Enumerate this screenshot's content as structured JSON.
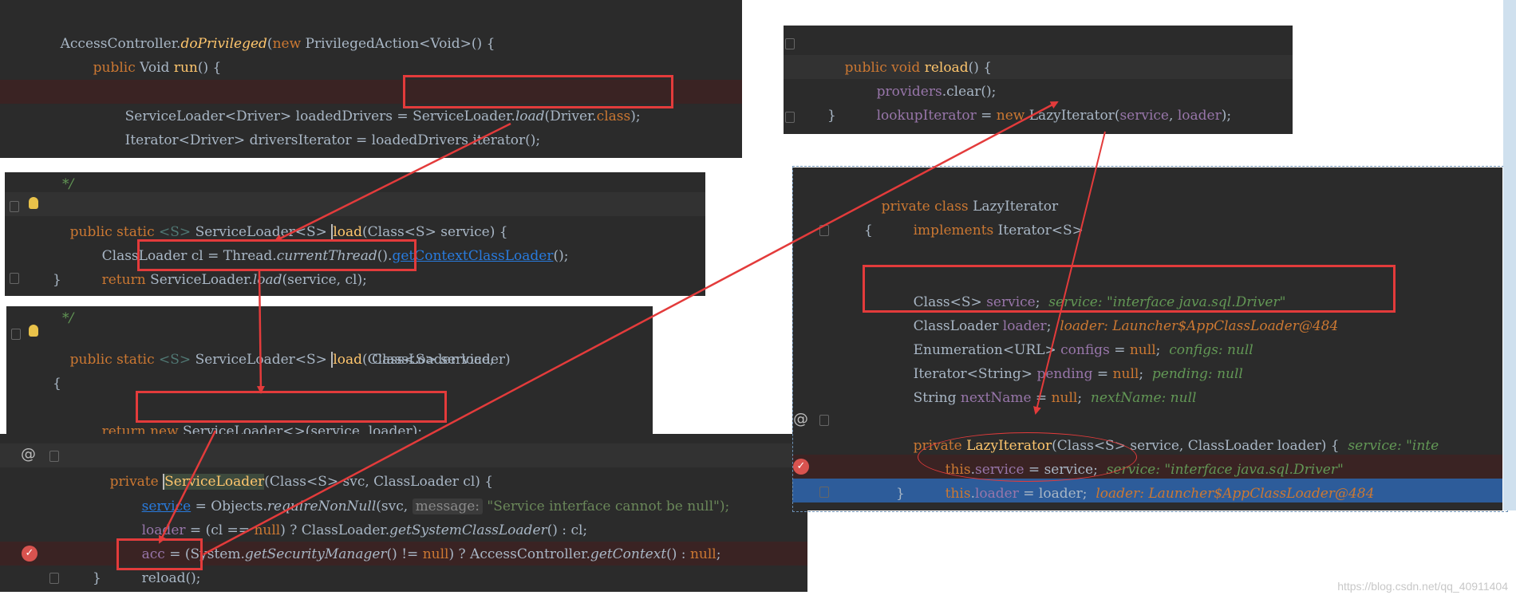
{
  "panels": {
    "p1": {
      "l1": [
        "AccessController.",
        "doPrivileged",
        "(",
        "new ",
        "PrivilegedAction<Void>() {"
      ],
      "l2": [
        "public ",
        "Void ",
        "run",
        "() {"
      ],
      "l3": [
        "ServiceLoader<Driver> loadedDrivers = ",
        "ServiceLoader.",
        "load",
        "(Driver.",
        "class",
        ");"
      ],
      "l4": [
        "Iterator<Driver> driversIterator = loadedDrivers.iterator();"
      ]
    },
    "p2": {
      "l0": [
        "*/"
      ],
      "l1": [
        "public static ",
        "<S> ",
        "ServiceLoader<S> ",
        "load",
        "(Class<S> service) {"
      ],
      "l2": [
        "ClassLoader cl = Thread.",
        "currentThread",
        "().",
        "getContextClassLoader",
        "();"
      ],
      "l3": [
        "return ",
        "ServiceLoader.",
        "load",
        "(service, cl);"
      ],
      "l4": [
        "}"
      ]
    },
    "p3": {
      "l0": [
        "*/"
      ],
      "l1": [
        "public static ",
        "<S> ",
        "ServiceLoader<S> ",
        "load",
        "(Class<S> service,"
      ],
      "l2": [
        "ClassLoader loader)"
      ],
      "l3": [
        "{"
      ],
      "l4": [
        "return ",
        "new ",
        "ServiceLoader<>(service, loader);"
      ]
    },
    "p4": {
      "l1": [
        "private ",
        "ServiceLoader",
        "(Class<S> svc, ClassLoader cl) {"
      ],
      "l2": [
        "service",
        " = Objects.",
        "requireNonNull",
        "(svc, ",
        "message:",
        " \"Service interface cannot be null\");"
      ],
      "l3": [
        "loader",
        " = (cl == ",
        "null",
        ") ? ClassLoader.",
        "getSystemClassLoader",
        "() : cl;"
      ],
      "l4": [
        "acc",
        " = (System.",
        "getSecurityManager",
        "() != ",
        "null",
        ") ? AccessController.",
        "getContext",
        "() : ",
        "null",
        ";"
      ],
      "l5": [
        "reload",
        "();"
      ],
      "l6": [
        "}"
      ]
    },
    "p5": {
      "l1": [
        "public void ",
        "reload",
        "() {"
      ],
      "l2": [
        "providers",
        ".clear();"
      ],
      "l3": [
        "lookupIterator",
        " = ",
        "new ",
        "LazyIterator(",
        "service",
        ", ",
        "loader",
        ");"
      ],
      "l4": [
        "}"
      ]
    },
    "p6": {
      "l1": [
        "private class ",
        "LazyIterator"
      ],
      "l2": [
        "implements ",
        "Iterator<S>"
      ],
      "l3": [
        "{"
      ],
      "l4": [
        "Class<S> ",
        "service",
        ";  ",
        "service: \"interface java.sql.Driver\""
      ],
      "l5": [
        "ClassLoader ",
        "loader",
        ";  ",
        "loader: Launcher$AppClassLoader@484"
      ],
      "l6": [
        "Enumeration<URL> ",
        "configs",
        " = ",
        "null",
        ";  ",
        "configs: null"
      ],
      "l7": [
        "Iterator<String> ",
        "pending",
        " = ",
        "null",
        ";  ",
        "pending: null"
      ],
      "l8": [
        "String ",
        "nextName",
        " = ",
        "null",
        ";  ",
        "nextName: null"
      ],
      "l9": [
        "private ",
        "LazyIterator",
        "(Class<S> service, ClassLoader loader) {  ",
        "service: \"inte"
      ],
      "l10": [
        "this",
        ".",
        "service",
        " = service;  ",
        "service: \"interface java.sql.Driver\""
      ],
      "l11": [
        "this",
        ".",
        "loader",
        " = loader;  ",
        "loader: Launcher$AppClassLoader@484"
      ],
      "l12": [
        "}"
      ]
    }
  },
  "watermark": "https://blog.csdn.net/qq_40911404",
  "colors": {
    "editor_bg": "#2b2b2b",
    "annotation_red": "#e33b3b",
    "keyword": "#cc7832",
    "selection_line": "#2d5c9a"
  }
}
